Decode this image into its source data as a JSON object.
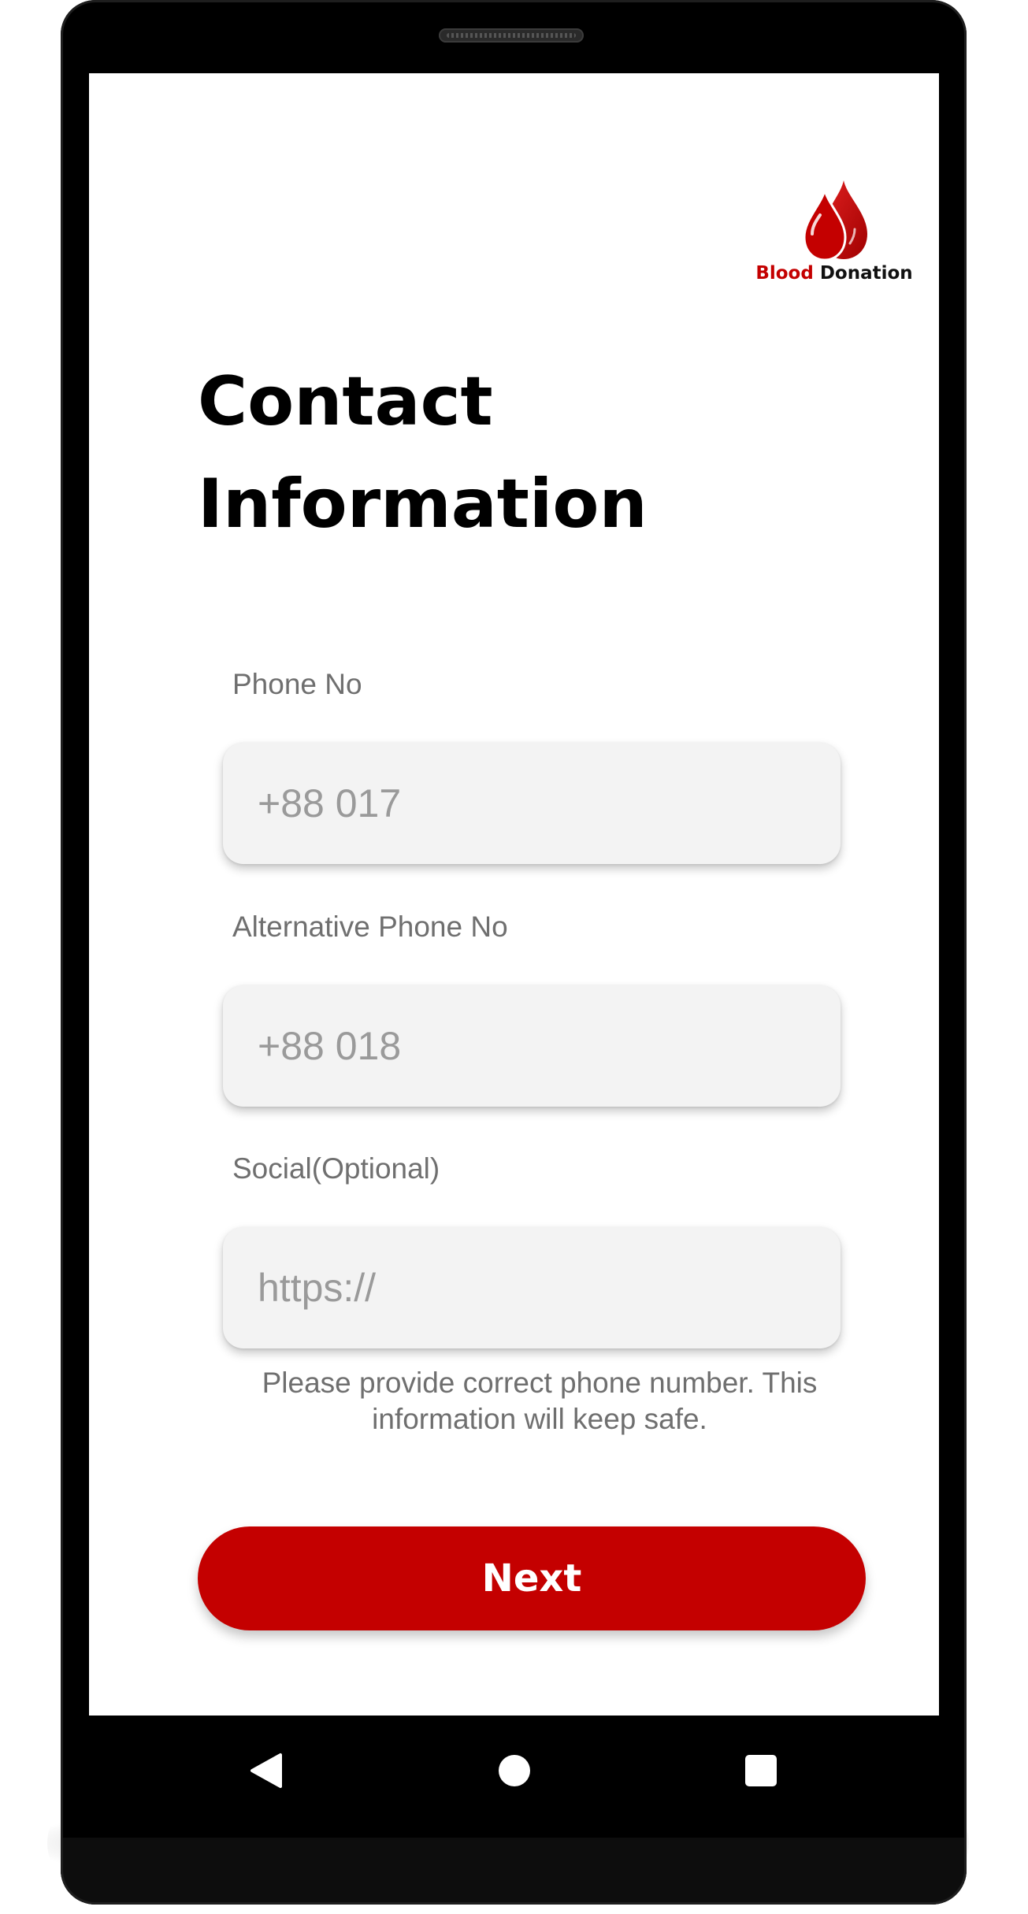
{
  "logo": {
    "word1": "Blood",
    "word2": "Donation",
    "icon": "blood-drops-icon"
  },
  "page": {
    "title_line1": "Contact",
    "title_line2": "Information"
  },
  "form": {
    "phone": {
      "label": "Phone No",
      "placeholder": "+88 017",
      "value": ""
    },
    "alt_phone": {
      "label": "Alternative Phone No",
      "placeholder": "+88 018",
      "value": ""
    },
    "social": {
      "label": "Social(Optional)",
      "placeholder": "https://",
      "value": ""
    }
  },
  "hint": {
    "line1": "Please provide correct phone number. This",
    "line2": "information will keep safe."
  },
  "actions": {
    "next_label": "Next"
  },
  "nav": {
    "back_icon": "back-triangle-icon",
    "home_icon": "home-circle-icon",
    "recent_icon": "recents-square-icon"
  },
  "colors": {
    "accent": "#c40000",
    "field_bg": "#f3f3f3",
    "label_text": "#6f6f6f",
    "placeholder_text": "#9a9a9a",
    "title_text": "#000000"
  }
}
